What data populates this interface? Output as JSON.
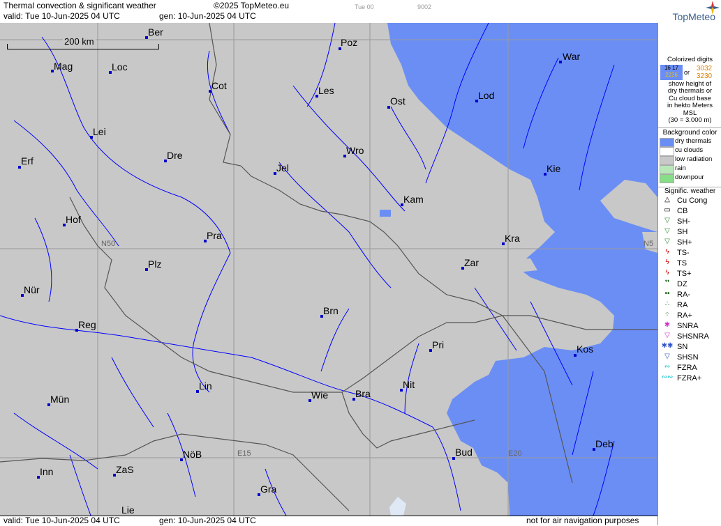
{
  "header": {
    "title": "Thermal convection & significant weather",
    "copyright": "©2025 TopMeteo.eu",
    "valid": "valid:  Tue  10-Jun-2025  04 UTC",
    "gen": "gen: 10-Jun-2025 04 UTC",
    "day_code": "Tue 00",
    "code": "9002",
    "brand": "TopMeteo"
  },
  "footer": {
    "valid": "valid:  Tue  10-Jun-2025  04 UTC",
    "gen": "gen: 10-Jun-2025 04 UTC",
    "note": "not for air navigation purposes"
  },
  "map": {
    "scale_label": "200 km",
    "grid_labels": [
      "N50",
      "E15",
      "E20",
      "N5"
    ],
    "cities": [
      "Ber",
      "Poz",
      "War",
      "Mag",
      "Loc",
      "Cot",
      "Les",
      "Ost",
      "Lod",
      "Lei",
      "Erf",
      "Dre",
      "Wro",
      "Jel",
      "Kie",
      "Kam",
      "Hof",
      "Pra",
      "Kra",
      "Plz",
      "Zar",
      "Nür",
      "Brn",
      "Reg",
      "Pri",
      "Kos",
      "Lin",
      "Nit",
      "Wie",
      "Bra",
      "Mün",
      "NöB",
      "Bud",
      "E20",
      "Deb",
      "Inn",
      "ZaS",
      "Gra",
      "Lie"
    ]
  },
  "legend": {
    "colorized_title": "Colorized digits",
    "digits_a": "16",
    "digits_b": "17",
    "digits_c": "22",
    "digits_d": "26",
    "or": "or",
    "digits_e": "30",
    "digits_f": "32",
    "digits_g": "32",
    "digits_h": "30",
    "explain_1": "show height of",
    "explain_2": "dry thermals or",
    "explain_3": "Cu cloud base",
    "explain_4": "in hekto Meters",
    "explain_5": "MSL",
    "explain_6": "(30 = 3.000 m)",
    "bg_title": "Background color",
    "bg_items": [
      {
        "label": "dry thermals",
        "color": "#6b8ef5"
      },
      {
        "label": "cu clouds",
        "color": "#ffffff"
      },
      {
        "label": "low radiation",
        "color": "#c8c8c8"
      },
      {
        "label": "rain",
        "color": "#b8e8b8"
      },
      {
        "label": "downpour",
        "color": "#88dd88"
      }
    ],
    "sig_title": "Signific. weather",
    "sig_items": [
      {
        "label": "Cu Cong",
        "icon": "cu-cong-icon",
        "glyph": "△",
        "color": "#000"
      },
      {
        "label": "CB",
        "icon": "cb-icon",
        "glyph": "▭",
        "color": "#000"
      },
      {
        "label": "SH-",
        "icon": "showers-light-icon",
        "glyph": "▽",
        "color": "#2a8a2a"
      },
      {
        "label": "SH",
        "icon": "showers-icon",
        "glyph": "▽",
        "color": "#2a8a2a"
      },
      {
        "label": "SH+",
        "icon": "showers-heavy-icon",
        "glyph": "▽",
        "color": "#2a8a2a"
      },
      {
        "label": "TS-",
        "icon": "thunderstorm-light-icon",
        "glyph": "ϟ",
        "color": "#cc0000"
      },
      {
        "label": "TS",
        "icon": "thunderstorm-icon",
        "glyph": "ϟ",
        "color": "#cc0000"
      },
      {
        "label": "TS+",
        "icon": "thunderstorm-heavy-icon",
        "glyph": "ϟ",
        "color": "#cc0000"
      },
      {
        "label": "DZ",
        "icon": "drizzle-icon",
        "glyph": "❜❜",
        "color": "#005500"
      },
      {
        "label": "RA-",
        "icon": "rain-light-icon",
        "glyph": "••",
        "color": "#005500"
      },
      {
        "label": "RA",
        "icon": "rain-icon",
        "glyph": "∴",
        "color": "#005500"
      },
      {
        "label": "RA+",
        "icon": "rain-heavy-icon",
        "glyph": "⁘",
        "color": "#005500"
      },
      {
        "label": "SNRA",
        "icon": "snow-rain-icon",
        "glyph": "✱",
        "color": "#cc33cc"
      },
      {
        "label": "SHSNRA",
        "icon": "snow-rain-showers-icon",
        "glyph": "▽",
        "color": "#cc33cc"
      },
      {
        "label": "SN",
        "icon": "snow-icon",
        "glyph": "✱✱",
        "color": "#3355cc"
      },
      {
        "label": "SHSN",
        "icon": "snow-showers-icon",
        "glyph": "▽",
        "color": "#3355cc"
      },
      {
        "label": "FZRA",
        "icon": "freezing-rain-icon",
        "glyph": "∾",
        "color": "#00bbcc"
      },
      {
        "label": "FZRA+",
        "icon": "freezing-rain-heavy-icon",
        "glyph": "∾∾",
        "color": "#00bbcc"
      }
    ]
  }
}
